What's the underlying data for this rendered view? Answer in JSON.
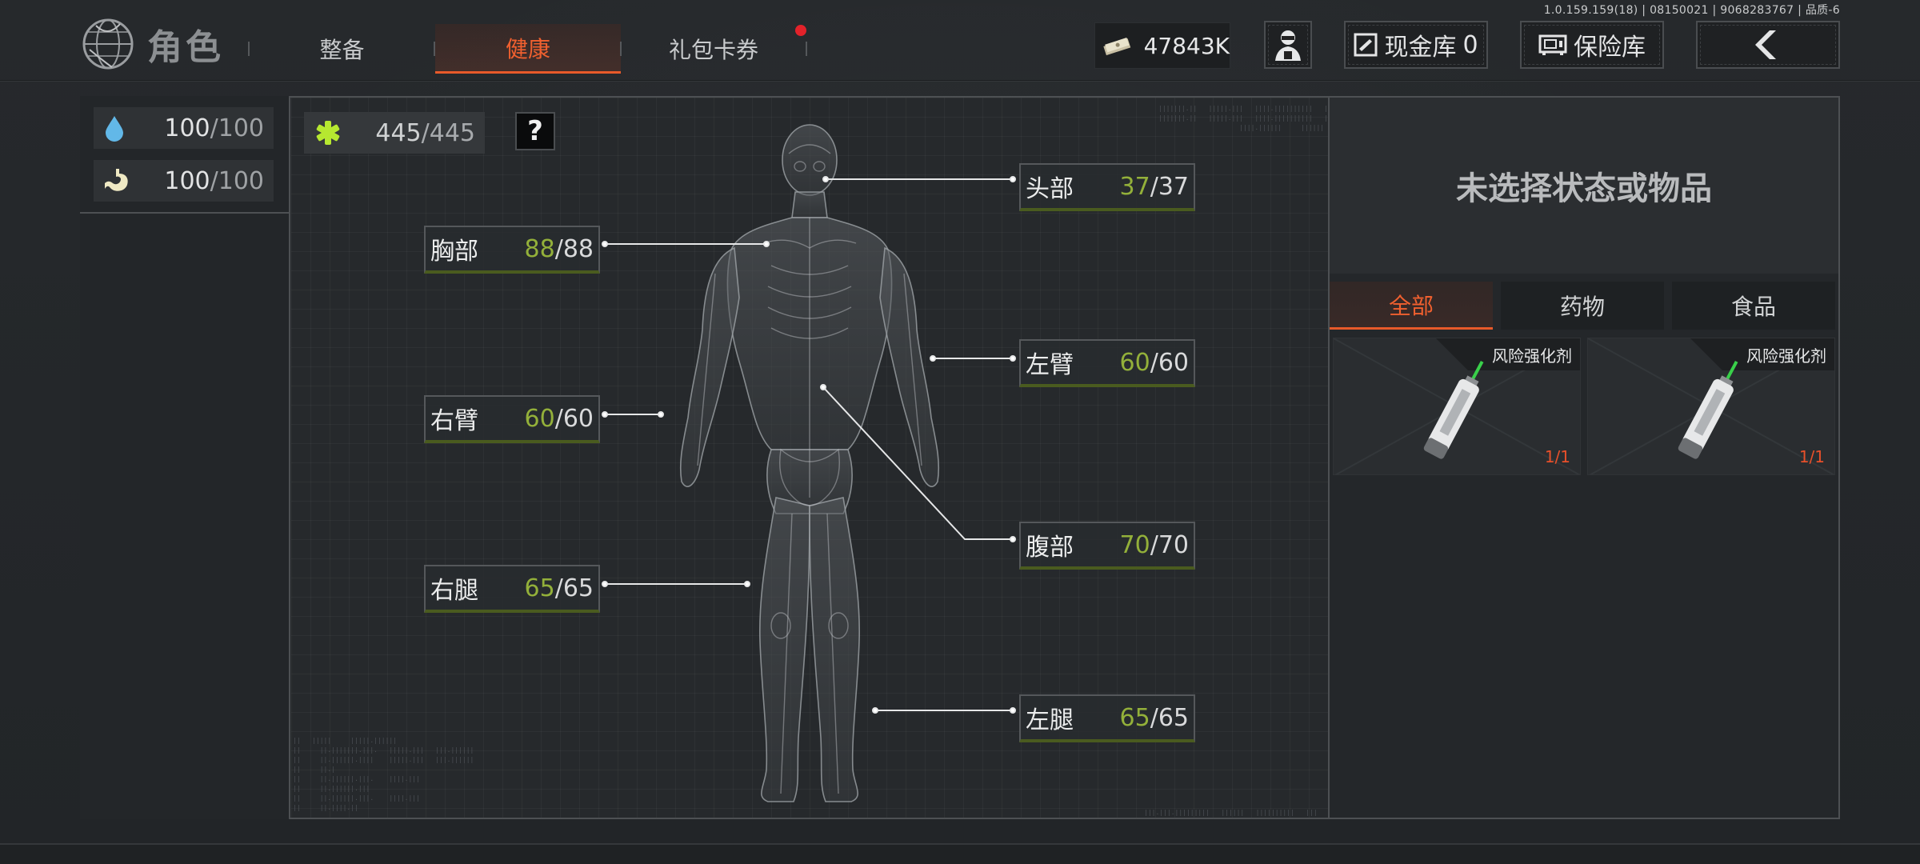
{
  "version": "1.0.159.159(18) | 08150021 | 9068283767 | 品质-6",
  "header": {
    "title": "角色",
    "tabs": [
      {
        "label": "整备",
        "active": false
      },
      {
        "label": "健康",
        "active": true
      },
      {
        "label": "礼包卡券",
        "active": false,
        "notification": true
      }
    ],
    "money": "47843K",
    "cash_vault_label": "现金库",
    "cash_vault_count": "0",
    "safe_label": "保险库"
  },
  "vitals": {
    "water": {
      "icon": "water-drop-icon",
      "current": "100",
      "max": "/100"
    },
    "food": {
      "icon": "stomach-icon",
      "current": "100",
      "max": "/100"
    }
  },
  "health": {
    "total_current": "445",
    "total_max": "/445",
    "help_label": "?",
    "parts": {
      "head": {
        "label": "头部",
        "current": "37",
        "max": "/37"
      },
      "chest": {
        "label": "胸部",
        "current": "88",
        "max": "/88"
      },
      "left_arm": {
        "label": "左臂",
        "current": "60",
        "max": "/60"
      },
      "right_arm": {
        "label": "右臂",
        "current": "60",
        "max": "/60"
      },
      "abdomen": {
        "label": "腹部",
        "current": "70",
        "max": "/70"
      },
      "right_leg": {
        "label": "右腿",
        "current": "65",
        "max": "/65"
      },
      "left_leg": {
        "label": "左腿",
        "current": "65",
        "max": "/65"
      }
    }
  },
  "detail": {
    "empty_message": "未选择状态或物品",
    "categories": [
      {
        "label": "全部",
        "active": true
      },
      {
        "label": "药物",
        "active": false
      },
      {
        "label": "食品",
        "active": false
      }
    ],
    "items": [
      {
        "name": "风险强化剂",
        "count": "1/1",
        "icon": "syringe-icon"
      },
      {
        "name": "风险强化剂",
        "count": "1/1",
        "icon": "syringe-icon"
      }
    ]
  },
  "colors": {
    "accent": "#e85a2a",
    "health_value": "#93b03a",
    "alert_dot": "#e3222a"
  }
}
